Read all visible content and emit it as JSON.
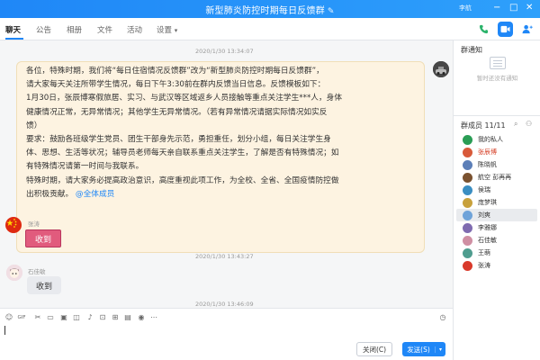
{
  "window": {
    "title": "新型肺炎防控时期每日反馈群",
    "account": "李航",
    "controls": [
      "−",
      "□",
      "✕"
    ]
  },
  "tabs": [
    {
      "label": "聊天",
      "active": true
    },
    {
      "label": "公告",
      "active": false
    },
    {
      "label": "相册",
      "active": false
    },
    {
      "label": "文件",
      "active": false
    },
    {
      "label": "活动",
      "active": false
    },
    {
      "label": "设置",
      "active": false
    }
  ],
  "settings_caret": "▾",
  "toolbar_icons": [
    "phone-icon",
    "video-icon",
    "add-member-icon"
  ],
  "messages": [
    {
      "timestamp": "2020/1/30 13:34:07",
      "lines": [
        "各位，特殊时期，我们将“每日住宿情况反馈群”改为“新型肺炎防控时期每日反馈群”，",
        "请大家每天关注所带学生情况，每日下午3:30前在群内反馈当日信息。反馈模板如下：",
        "1月30日，张辰博寒假旅居、实习、与武汉等区域返乡人员接触等重点关注学生***人，身体",
        "健康情况正常，无异常情况；其他学生无异常情况。（若有异常情况请据实际情况如实反",
        "馈）",
        "要求：鼓励各班级学生党员、团生干部身先示范，勇担重任，划分小组，每日关注学生身",
        "体、思想、生活等状况；辅导员老师每天亲自联系重点关注学生，了解是否有特殊情况；如",
        "有特殊情况请第一时间与我联系。",
        "特殊时期，请大家务必提高政治意识，高度重视此项工作，为全校、全省、全国疫情防控做"
      ],
      "last_line": "出积极贡献。",
      "mention": "@全体成员"
    },
    {
      "sender": "张涛",
      "text": "收到"
    },
    {
      "timestamp": "2020/1/30 13:43:27",
      "sender": "石佳敏",
      "text": "收到"
    },
    {
      "timestamp": "2020/1/30 13:46:09"
    }
  ],
  "input": {
    "tool_icons": [
      "emoji-icon",
      "gif-icon",
      "scissors-icon",
      "folder-icon",
      "image-icon",
      "shake-icon",
      "voice-icon",
      "remote-icon",
      "grid-icon",
      "red-packet-icon",
      "mic-icon",
      "more-icon"
    ],
    "close_label": "关闭(C)",
    "send_label": "发送(S)",
    "send_caret": "▾"
  },
  "right_panel": {
    "notice_title": "群通知",
    "notice_empty": "暂时还没有通知",
    "members_title": "群成员 11/11",
    "members": [
      {
        "name": "我的私人",
        "color": "#2a9d55"
      },
      {
        "name": "张辰博",
        "color": "#d85a3a"
      },
      {
        "name": "陈晓帆",
        "color": "#5c7fb8"
      },
      {
        "name": "航空 彭再再",
        "color": "#7a5230"
      },
      {
        "name": "侯瑞",
        "color": "#3b8ec2"
      },
      {
        "name": "庞梦琪",
        "color": "#c8a13c"
      },
      {
        "name": "刘爽",
        "color": "#6fa3d9"
      },
      {
        "name": "李雅娜",
        "color": "#7f6bb0"
      },
      {
        "name": "石佳敏",
        "color": "#cf8fa3"
      },
      {
        "name": "王萌",
        "color": "#4f9d8f"
      },
      {
        "name": "张涛",
        "color": "#d93a2b"
      }
    ]
  }
}
